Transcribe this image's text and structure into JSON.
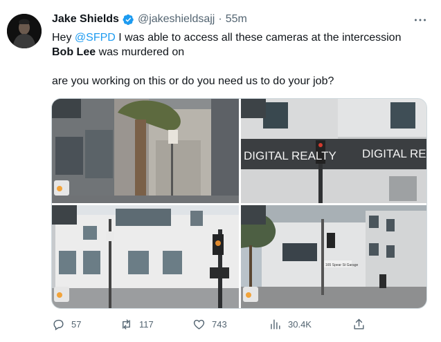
{
  "author": {
    "name": "Jake Shields",
    "handle": "@jakeshieldsajj",
    "separator": "·",
    "time": "55m"
  },
  "icons": {
    "verified": "verified-badge-icon",
    "more": "more-options-icon",
    "reply": "reply-icon",
    "retweet": "retweet-icon",
    "like": "like-icon",
    "views": "views-icon",
    "share": "share-icon"
  },
  "colors": {
    "accent": "#1d9bf0",
    "text": "#0f1419",
    "secondary": "#536471"
  },
  "tweet": {
    "line1_pre": "Hey ",
    "mention": "@SFPD",
    "line1_post": " I was able to access all these cameras at the intercession",
    "bold_name": "Bob Lee",
    "line2_post": " was murdered on",
    "line3": "are you working on this or do you need us to do your job?"
  },
  "media": {
    "sign_left": "DIGITAL REALTY",
    "sign_right": "DIGITAL REA",
    "plate": "165 Spear St Garage"
  },
  "stats": {
    "replies": "57",
    "retweets": "117",
    "likes": "743",
    "views": "30.4K"
  }
}
